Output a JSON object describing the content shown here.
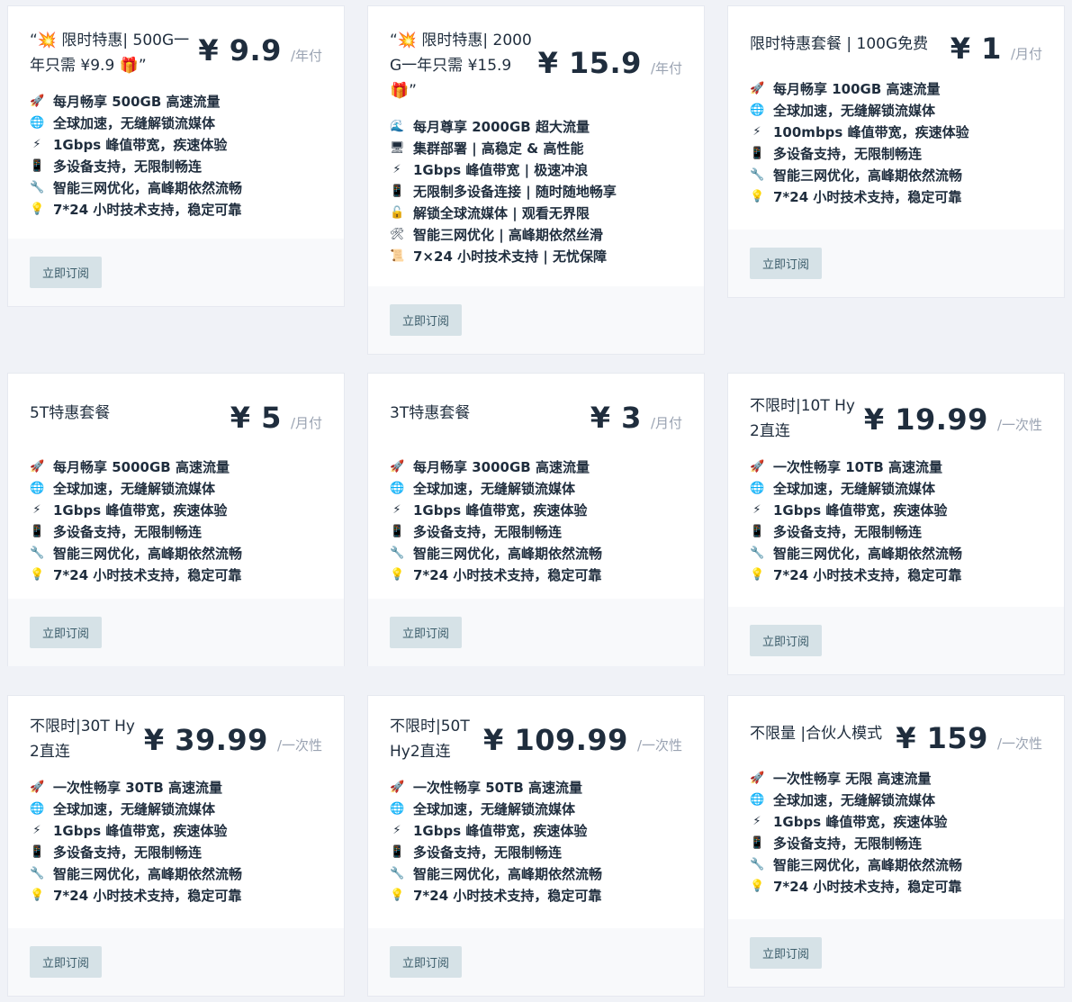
{
  "button_label": "立即订阅",
  "plans": [
    {
      "title": "“💥 限时特惠| 500G一年只需 ¥9.9 🎁”",
      "price": "¥ 9.9",
      "period": "/年付",
      "features": [
        {
          "icon": "🚀",
          "text": "每月畅享 500GB 高速流量"
        },
        {
          "icon": "🌐",
          "text": "全球加速，无缝解锁流媒体"
        },
        {
          "icon": "⚡",
          "text": "1Gbps 峰值带宽，疾速体验"
        },
        {
          "icon": "📱",
          "text": "多设备支持，无限制畅连"
        },
        {
          "icon": "🔧",
          "text": "智能三网优化，高峰期依然流畅"
        },
        {
          "icon": "💡",
          "text": "7*24 小时技术支持，稳定可靠"
        }
      ]
    },
    {
      "title": "“💥 限时特惠| 2000G一年只需 ¥15.9 🎁”",
      "price": "¥ 15.9",
      "period": "/年付",
      "features": [
        {
          "icon": "🌊",
          "text": "每月尊享 2000GB 超大流量"
        },
        {
          "icon": "🖥",
          "text": "集群部署 | 高稳定 & 高性能"
        },
        {
          "icon": "⚡",
          "text": "1Gbps 峰值带宽 | 极速冲浪"
        },
        {
          "icon": "📱",
          "text": "无限制多设备连接 | 随时随地畅享"
        },
        {
          "icon": "🔓",
          "text": "解锁全球流媒体 | 观看无界限"
        },
        {
          "icon": "🛠",
          "text": "智能三网优化 | 高峰期依然丝滑"
        },
        {
          "icon": "📜",
          "text": "7×24 小时技术支持 | 无忧保障"
        }
      ]
    },
    {
      "title": "限时特惠套餐 | 100G免费",
      "price": "¥ 1",
      "period": "/月付",
      "features": [
        {
          "icon": "🚀",
          "text": "每月畅享 100GB 高速流量"
        },
        {
          "icon": "🌐",
          "text": "全球加速，无缝解锁流媒体"
        },
        {
          "icon": "⚡",
          "text": "100mbps 峰值带宽，疾速体验"
        },
        {
          "icon": "📱",
          "text": "多设备支持，无限制畅连"
        },
        {
          "icon": "🔧",
          "text": "智能三网优化，高峰期依然流畅"
        },
        {
          "icon": "💡",
          "text": "7*24 小时技术支持，稳定可靠"
        }
      ]
    },
    {
      "title": "5T特惠套餐",
      "price": "¥ 5",
      "period": "/月付",
      "features": [
        {
          "icon": "🚀",
          "text": "每月畅享 5000GB 高速流量"
        },
        {
          "icon": "🌐",
          "text": "全球加速，无缝解锁流媒体"
        },
        {
          "icon": "⚡",
          "text": "1Gbps 峰值带宽，疾速体验"
        },
        {
          "icon": "📱",
          "text": "多设备支持，无限制畅连"
        },
        {
          "icon": "🔧",
          "text": "智能三网优化，高峰期依然流畅"
        },
        {
          "icon": "💡",
          "text": "7*24 小时技术支持，稳定可靠"
        }
      ]
    },
    {
      "title": "3T特惠套餐",
      "price": "¥ 3",
      "period": "/月付",
      "features": [
        {
          "icon": "🚀",
          "text": "每月畅享 3000GB 高速流量"
        },
        {
          "icon": "🌐",
          "text": "全球加速，无缝解锁流媒体"
        },
        {
          "icon": "⚡",
          "text": "1Gbps 峰值带宽，疾速体验"
        },
        {
          "icon": "📱",
          "text": "多设备支持，无限制畅连"
        },
        {
          "icon": "🔧",
          "text": "智能三网优化，高峰期依然流畅"
        },
        {
          "icon": "💡",
          "text": "7*24 小时技术支持，稳定可靠"
        }
      ]
    },
    {
      "title": "不限时|10T Hy2直连",
      "price": "¥ 19.99",
      "period": "/一次性",
      "features": [
        {
          "icon": "🚀",
          "text": "一次性畅享 10TB 高速流量"
        },
        {
          "icon": "🌐",
          "text": "全球加速，无缝解锁流媒体"
        },
        {
          "icon": "⚡",
          "text": "1Gbps 峰值带宽，疾速体验"
        },
        {
          "icon": "📱",
          "text": "多设备支持，无限制畅连"
        },
        {
          "icon": "🔧",
          "text": "智能三网优化，高峰期依然流畅"
        },
        {
          "icon": "💡",
          "text": "7*24 小时技术支持，稳定可靠"
        }
      ]
    },
    {
      "title": "不限时|30T Hy2直连",
      "price": "¥ 39.99",
      "period": "/一次性",
      "features": [
        {
          "icon": "🚀",
          "text": "一次性畅享 30TB 高速流量"
        },
        {
          "icon": "🌐",
          "text": "全球加速，无缝解锁流媒体"
        },
        {
          "icon": "⚡",
          "text": "1Gbps 峰值带宽，疾速体验"
        },
        {
          "icon": "📱",
          "text": "多设备支持，无限制畅连"
        },
        {
          "icon": "🔧",
          "text": "智能三网优化，高峰期依然流畅"
        },
        {
          "icon": "💡",
          "text": "7*24 小时技术支持，稳定可靠"
        }
      ]
    },
    {
      "title": "不限时|50T Hy2直连",
      "price": "¥ 109.99",
      "period": "/一次性",
      "features": [
        {
          "icon": "🚀",
          "text": "一次性畅享 50TB 高速流量"
        },
        {
          "icon": "🌐",
          "text": "全球加速，无缝解锁流媒体"
        },
        {
          "icon": "⚡",
          "text": "1Gbps 峰值带宽，疾速体验"
        },
        {
          "icon": "📱",
          "text": "多设备支持，无限制畅连"
        },
        {
          "icon": "🔧",
          "text": "智能三网优化，高峰期依然流畅"
        },
        {
          "icon": "💡",
          "text": "7*24 小时技术支持，稳定可靠"
        }
      ]
    },
    {
      "title": "不限量 |合伙人模式",
      "price": "¥ 159",
      "period": "/一次性",
      "features": [
        {
          "icon": "🚀",
          "text": "一次性畅享 无限 高速流量"
        },
        {
          "icon": "🌐",
          "text": "全球加速，无缝解锁流媒体"
        },
        {
          "icon": "⚡",
          "text": "1Gbps 峰值带宽，疾速体验"
        },
        {
          "icon": "📱",
          "text": "多设备支持，无限制畅连"
        },
        {
          "icon": "🔧",
          "text": "智能三网优化，高峰期依然流畅"
        },
        {
          "icon": "💡",
          "text": "7*24 小时技术支持，稳定可靠"
        }
      ]
    }
  ]
}
